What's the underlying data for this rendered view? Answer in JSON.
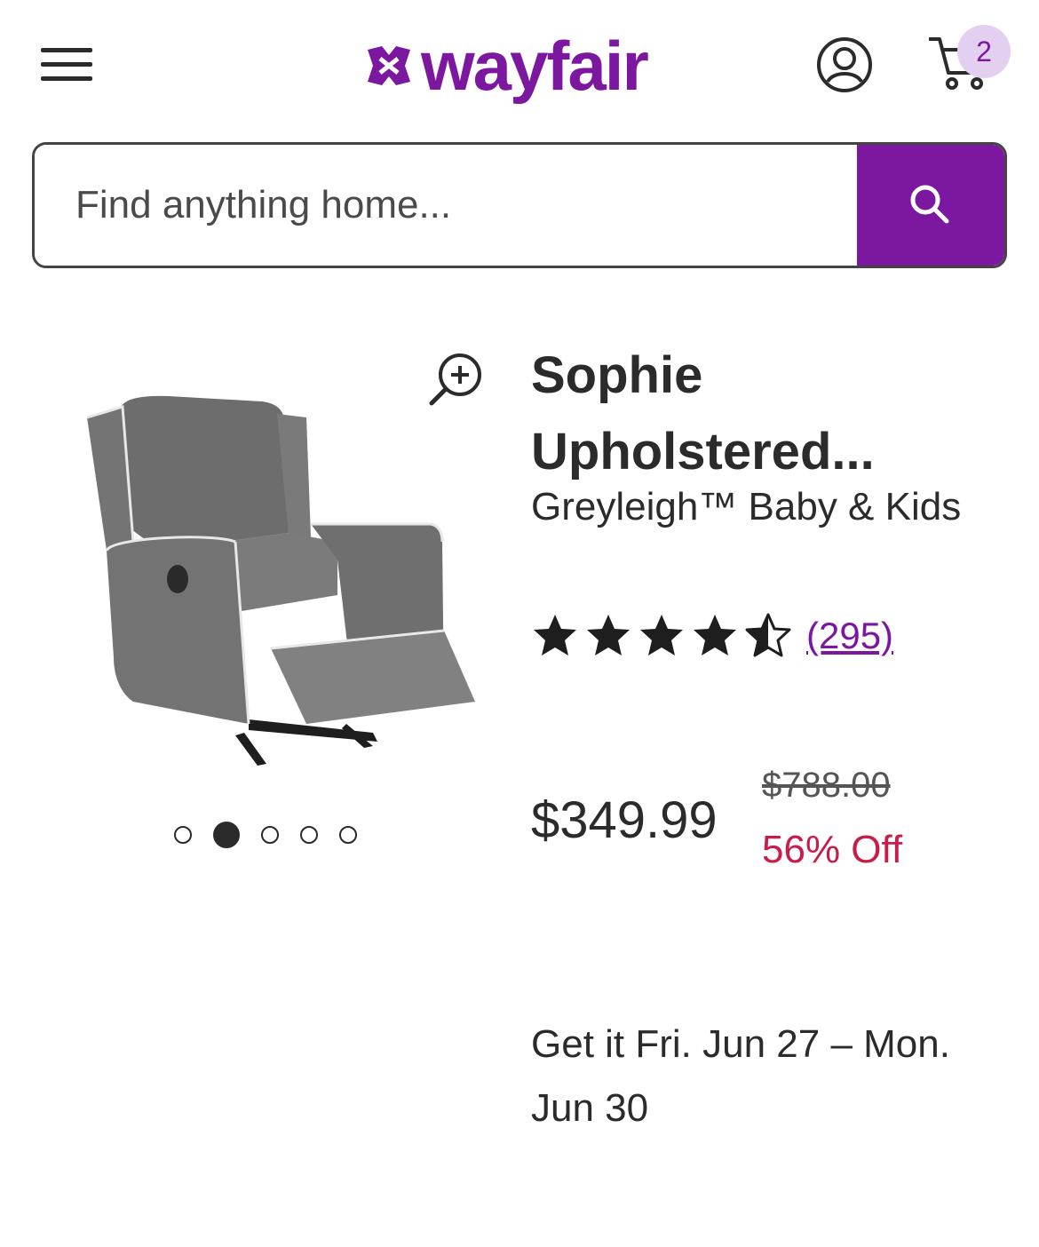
{
  "header": {
    "logo_text": "wayfair",
    "cart_count": "2",
    "brand_color": "#7b189f"
  },
  "search": {
    "placeholder": "Find anything home..."
  },
  "icons": {
    "menu": "hamburger-menu-icon",
    "account": "account-icon",
    "cart": "cart-icon",
    "search": "search-icon",
    "zoom": "zoom-in-icon"
  },
  "product": {
    "title_line1": "Sophie",
    "title_line2": "Upholstered...",
    "brand": "Greyleigh™ Baby & Kids",
    "rating": 4.5,
    "reviews": "(295)",
    "price": "$349.99",
    "old_price": "$788.00",
    "discount": "56% Off",
    "delivery_line1": "Get it Fri. Jun 27 – Mon.",
    "delivery_line2": "Jun 30",
    "image_count": 5,
    "active_image": 2
  }
}
